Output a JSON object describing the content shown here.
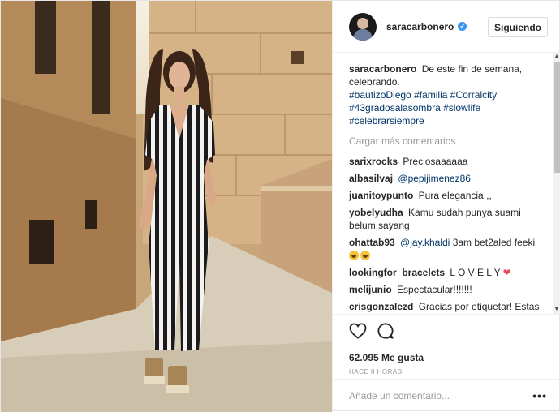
{
  "header": {
    "username": "saracarbonero",
    "verified_mark": "✓",
    "follow_label": "Siguiendo"
  },
  "caption": {
    "username": "saracarbonero",
    "text": "De este fin de semana, celebrando.",
    "hashtags": [
      "#bautizoDiego",
      "#familia",
      "#Corralcity",
      "#43gradosalasombra",
      "#slowlife",
      "#celebrarsiempre"
    ]
  },
  "load_more_label": "Cargar más comentarios",
  "comments": [
    {
      "user": "sarixrocks",
      "text": "Preciosaaaaaa"
    },
    {
      "user": "albasilvaj",
      "mention": "@pepijimenez86",
      "text": ""
    },
    {
      "user": "juanitoypunto",
      "text": "Pura elegancia,,,"
    },
    {
      "user": "yobelyudha",
      "text": "Kamu sudah punya suami belum sayang"
    },
    {
      "user": "ohattab93",
      "mention": "@jay.khaldi",
      "text": "3am bet2aled feeki"
    },
    {
      "user": "lookingfor_bracelets",
      "text": "L O V E L Y"
    },
    {
      "user": "melijunio",
      "text": "Espectacular!!!!!!!"
    },
    {
      "user": "crisgonzalezd",
      "text": "Gracias por etiquetar! Estas preciosa"
    }
  ],
  "icons": {
    "like": "heart-icon",
    "comment": "comment-bubble-icon",
    "verified": "verified-badge-icon",
    "more": "more-options-icon",
    "emoji_laugh": "laughing-emoji-icon",
    "emoji_heart": "red-heart-emoji-icon"
  },
  "stats": {
    "likes_label": "62.095 Me gusta",
    "time_label": "HACE 8 HORAS"
  },
  "add_comment": {
    "placeholder": "Añade un comentario...",
    "more_label": "•••"
  },
  "colors": {
    "link": "#003569",
    "verified": "#3897f0",
    "muted": "#999999",
    "heart": "#ed4956"
  }
}
